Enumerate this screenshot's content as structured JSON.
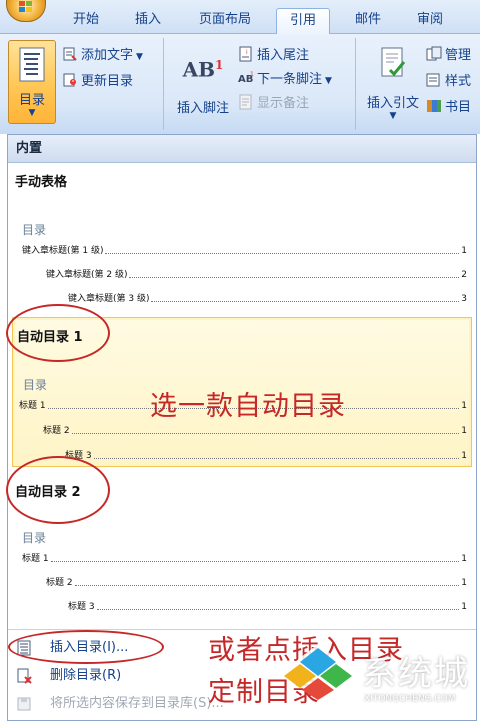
{
  "tabs": [
    "开始",
    "插入",
    "页面布局",
    "引用",
    "邮件",
    "审阅"
  ],
  "ribbon": {
    "toc_button": "目录",
    "add_text": "添加文字",
    "update_toc": "更新目录",
    "insert_footnote": "插入脚注",
    "footnote_icon_text": "AB",
    "footnote_superscript": "1",
    "insert_endnote": "插入尾注",
    "next_footnote": "下一条脚注",
    "show_notes": "显示备注",
    "insert_citation": "插入引文",
    "manage": "管理",
    "style": "样式",
    "bibliography": "书目"
  },
  "gallery": {
    "section_header": "内置",
    "items": [
      {
        "name": "手动表格",
        "preview_title": "目录",
        "lines": [
          {
            "text": "键入章标题(第 1 级)",
            "page": "1"
          },
          {
            "text": "键入章标题(第 2 级)",
            "page": "2"
          },
          {
            "text": "键入章标题(第 3 级)",
            "page": "3"
          }
        ]
      },
      {
        "name": "自动目录 1",
        "preview_title": "目录",
        "lines": [
          {
            "text": "标题 1",
            "page": "1"
          },
          {
            "text": "标题 2",
            "page": "1"
          },
          {
            "text": "标题 3",
            "page": "1"
          }
        ]
      },
      {
        "name": "自动目录 2",
        "preview_title": "目录",
        "lines": [
          {
            "text": "标题 1",
            "page": "1"
          },
          {
            "text": "标题 2",
            "page": "1"
          },
          {
            "text": "标题 3",
            "page": "1"
          }
        ]
      }
    ]
  },
  "menu": {
    "insert_toc": "插入目录(I)...",
    "remove_toc": "删除目录(R)",
    "save_selection": "将所选内容保存到目录库(S)..."
  },
  "annotations": {
    "pick_auto_toc": "选一款自动目录",
    "or_insert_line1": "或者点插入目录",
    "or_insert_line2": "定制目录"
  },
  "watermark": {
    "brand": "系统城",
    "domain": "XITONGCHENG.COM"
  },
  "colors": {
    "annotation_red": "#c62828",
    "ribbon_text": "#15428b",
    "highlight": "#f2c55c"
  }
}
